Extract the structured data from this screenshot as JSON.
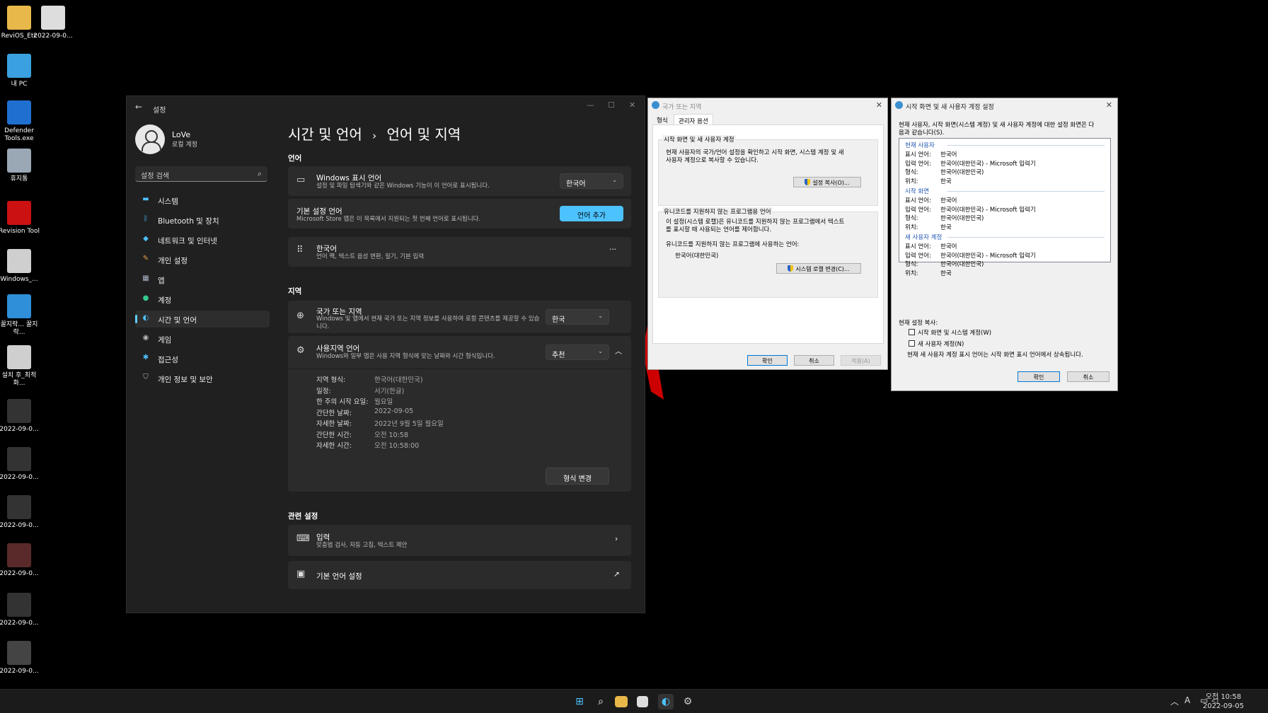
{
  "desktop": {
    "icons": [
      {
        "label": "ReviOS_Etc",
        "color": "#e8b84a"
      },
      {
        "label": "2022-09-0...",
        "color": "#dddddd"
      },
      {
        "label": "내 PC",
        "color": "#3aa0e0"
      },
      {
        "label": "Defender Tools.exe",
        "color": "#1f6fd1"
      },
      {
        "label": "휴지통",
        "color": "#9aa7b5"
      },
      {
        "label": "Revision Tool",
        "color": "#cc1111"
      },
      {
        "label": "Windows_...",
        "color": "#cfcfcf"
      },
      {
        "label": "꿀지락... 꿀지락...",
        "color": "#2f8fd8"
      },
      {
        "label": "설치 후_최적화...",
        "color": "#cfcfcf"
      },
      {
        "label": "2022-09-0...",
        "color": "#333333"
      },
      {
        "label": "2022-09-0...",
        "color": "#333333"
      },
      {
        "label": "2022-09-0...",
        "color": "#333333"
      },
      {
        "label": "2022-09-0...",
        "color": "#5a2a2a"
      },
      {
        "label": "2022-09-0...",
        "color": "#333333"
      },
      {
        "label": "2022-09-0...",
        "color": "#444444"
      }
    ]
  },
  "settings": {
    "title": "설정",
    "user": {
      "name": "LoVe",
      "account": "로컬 계정"
    },
    "search_placeholder": "설정 검색",
    "nav": [
      {
        "label": "시스템",
        "icon": "monitor-icon",
        "glyph": "▬",
        "color": "#4cc2ff"
      },
      {
        "label": "Bluetooth 및 장치",
        "icon": "bluetooth-icon",
        "glyph": "ᛒ",
        "color": "#4cc2ff"
      },
      {
        "label": "네트워크 및 인터넷",
        "icon": "wifi-icon",
        "glyph": "◆",
        "color": "#4cc2ff"
      },
      {
        "label": "개인 설정",
        "icon": "brush-icon",
        "glyph": "✎",
        "color": "#f0a050"
      },
      {
        "label": "앱",
        "icon": "apps-icon",
        "glyph": "▦",
        "color": "#aab4c8"
      },
      {
        "label": "계정",
        "icon": "account-icon",
        "glyph": "●",
        "color": "#35c98f"
      },
      {
        "label": "시간 및 언어",
        "icon": "globe-clock-icon",
        "glyph": "◐",
        "color": "#4cc2ff"
      },
      {
        "label": "게임",
        "icon": "gamepad-icon",
        "glyph": "◉",
        "color": "#bbbbbb"
      },
      {
        "label": "접근성",
        "icon": "accessibility-icon",
        "glyph": "✱",
        "color": "#4cc2ff"
      },
      {
        "label": "개인 정보 및 보안",
        "icon": "shield-icon",
        "glyph": "⛉",
        "color": "#bbbbbb"
      }
    ],
    "breadcrumb": {
      "parent": "시간 및 언어",
      "sep": "›",
      "current": "언어 및 지역"
    },
    "language_section": "언어",
    "display_language": {
      "title": "Windows 표시 언어",
      "desc": "설정 및 파일 탐색기와 같은 Windows 기능이 이 언어로 표시됩니다.",
      "value": "한국어"
    },
    "preferred": {
      "title": "기본 설정 언어",
      "desc": "Microsoft Store 앱은 이 목록에서 지원되는 첫 번째 언어로 표시됩니다.",
      "button": "언어 추가"
    },
    "korean": {
      "title": "한국어",
      "desc": "언어 팩, 텍스트 음성 변환, 필기, 기본 입력",
      "more": "···"
    },
    "region_section": "지역",
    "country": {
      "title": "국가 또는 지역",
      "desc": "Windows 및 앱에서 현재 국가 또는 지역 정보를 사용하여 로컬 콘텐츠를 제공할 수 있습니다.",
      "value": "한국"
    },
    "regional_format": {
      "title": "사용지역 언어",
      "desc": "Windows와 일부 앱은 사용 지역 형식에 맞는 날짜와 시간 형식입니다.",
      "value": "추천",
      "rows": [
        {
          "k": "지역 형식:",
          "v": "한국어(대한민국)"
        },
        {
          "k": "일정:",
          "v": "서기(한글)"
        },
        {
          "k": "한 주의 시작 요일:",
          "v": "월요일"
        },
        {
          "k": "간단한 날짜:",
          "v": "2022-09-05"
        },
        {
          "k": "자세한 날짜:",
          "v": "2022년 9월 5일 월요일"
        },
        {
          "k": "간단한 시간:",
          "v": "오전 10:58"
        },
        {
          "k": "자세한 시간:",
          "v": "오전 10:58:00"
        }
      ],
      "button": "형식 변경"
    },
    "related_section": "관련 설정",
    "typing": {
      "title": "입력",
      "desc": "맞춤법 검사, 자동 고침, 텍스트 제안"
    },
    "admin_lang": {
      "title": "기본 언어 설정"
    }
  },
  "region_dialog": {
    "title": "국가 또는 지역",
    "tabs": [
      "형식",
      "관리자 옵션"
    ],
    "group1": {
      "label": "시작 화면 및 새 사용자 계정",
      "text": [
        "현재 사용자의 국가/언어 설정을 확인하고 시작 화면, 시스템 계정 및 새",
        "사용자 계정으로 복사할 수 있습니다."
      ],
      "button": "설정 복사(O)..."
    },
    "group2": {
      "label": "유니코드를 지원하지 않는 프로그램용 언어",
      "text": [
        "이 설정(시스템 로캘)은 유니코드를 지원하지 않는 프로그램에서 텍스트",
        "를 표시할 때 사용되는 언어를 제어합니다."
      ],
      "current_label": "유니코드를 지원하지 않는 프로그램에 사용하는 언어:",
      "current_value": "한국어(대한민국)",
      "button": "시스템 로캘 변경(C)..."
    },
    "ok": "확인",
    "cancel": "취소",
    "apply": "적용(A)"
  },
  "welcome_dialog": {
    "title": "시작 화면 및 새 사용자 계정 설정",
    "intro": [
      "현재 사용자, 시작 화면(시스템 계정) 및 새 사용자 계정에 대한 설정 화면은 다",
      "음과 같습니다(S)."
    ],
    "sections": [
      {
        "name": "현재 사용자",
        "rows": [
          {
            "k": "표시 언어:",
            "v": "한국어"
          },
          {
            "k": "입력 언어:",
            "v": "한국어(대한민국) - Microsoft 입력기"
          },
          {
            "k": "형식:",
            "v": "한국어(대한민국)"
          },
          {
            "k": "위치:",
            "v": "한국"
          }
        ]
      },
      {
        "name": "시작 화면",
        "rows": [
          {
            "k": "표시 언어:",
            "v": "한국어"
          },
          {
            "k": "입력 언어:",
            "v": "한국어(대한민국) - Microsoft 입력기"
          },
          {
            "k": "형식:",
            "v": "한국어(대한민국)"
          },
          {
            "k": "위치:",
            "v": "한국"
          }
        ]
      },
      {
        "name": "새 사용자 계정",
        "rows": [
          {
            "k": "표시 언어:",
            "v": "한국어"
          },
          {
            "k": "입력 언어:",
            "v": "한국어(대한민국) - Microsoft 입력기"
          },
          {
            "k": "형식:",
            "v": "한국어(대한민국)"
          },
          {
            "k": "위치:",
            "v": "한국"
          }
        ]
      }
    ],
    "copy_label": "현재 설정 복사:",
    "check1": "시작 화면 및 시스템 계정(W)",
    "check2": "새 사용자 계정(N)",
    "note": "현재 새 사용자 계정 표시 언어는 시작 화면 표시 언어에서 상속됩니다.",
    "ok": "확인",
    "cancel": "취소"
  },
  "taskbar": {
    "time": "오전 10:58",
    "date": "2022-09-05",
    "ime": "A"
  }
}
